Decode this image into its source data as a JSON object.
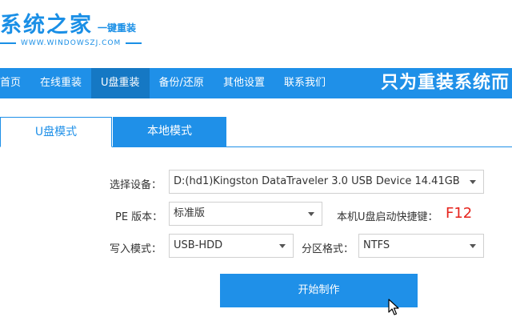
{
  "header": {
    "logo_text": "系统之家",
    "logo_sub": "一键重装",
    "logo_url": "WWW.WINDOWSZJ.COM"
  },
  "nav": {
    "items": [
      "首页",
      "在线重装",
      "U盘重装",
      "备份/还原",
      "其他设置",
      "联系我们"
    ],
    "active_index": 2,
    "slogan": "只为重装系统而"
  },
  "tabs": {
    "usb_mode": "U盘模式",
    "local_mode": "本地模式",
    "active": "U盘模式"
  },
  "form": {
    "device_label": "选择设备：",
    "device_value": "D:(hd1)Kingston DataTraveler 3.0 USB Device 14.41GB",
    "pe_label": "PE 版本：",
    "pe_value": "标准版",
    "hotkey_label": "本机U盘启动快捷键：",
    "hotkey_value": "F12",
    "write_label": "写入模式：",
    "write_value": "USB-HDD",
    "partition_label": "分区格式：",
    "partition_value": "NTFS"
  },
  "actions": {
    "start_label": "开始制作"
  },
  "colors": {
    "brand_blue": "#1f90e8",
    "hotkey_red": "#e6231c"
  },
  "icons": [
    "caret-down-icon",
    "mouse-cursor-icon"
  ]
}
